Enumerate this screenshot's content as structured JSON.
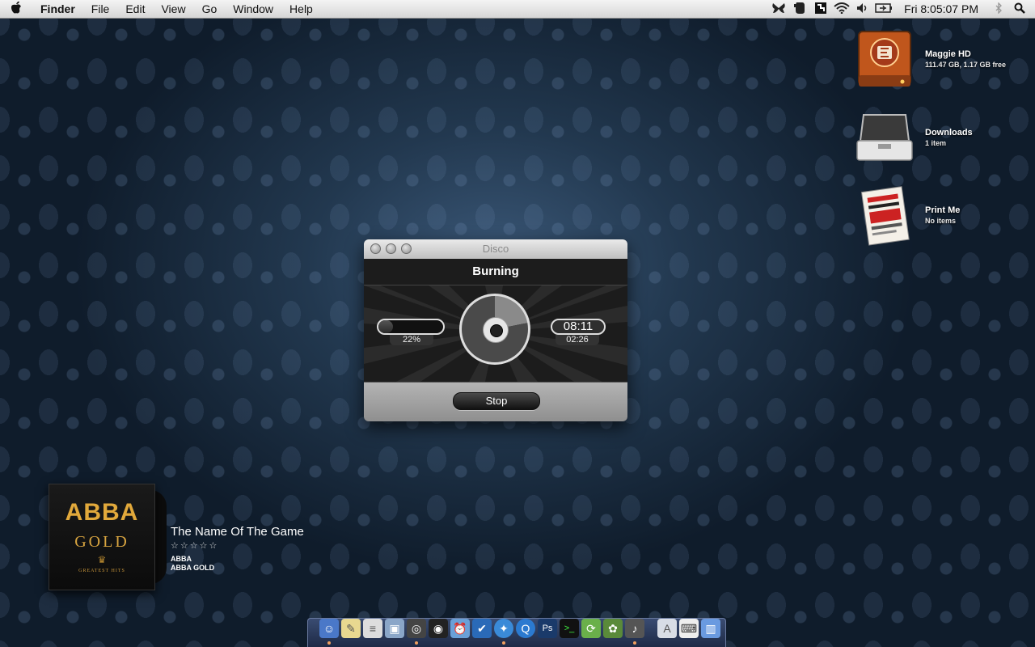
{
  "menubar": {
    "app_name": "Finder",
    "menus": [
      "File",
      "Edit",
      "View",
      "Go",
      "Window",
      "Help"
    ],
    "clock": "Fri 8:05:07 PM",
    "status_icons": [
      "butterfly-icon",
      "evernote-icon",
      "dropbox-icon",
      "wifi-icon",
      "volume-icon",
      "battery-icon",
      "bluetooth-icon",
      "spotlight-search-icon"
    ]
  },
  "desktop": {
    "items": [
      {
        "name": "Maggie HD",
        "subtitle": "111.47 GB, 1.17 GB free",
        "icon": "hard-drive-icon"
      },
      {
        "name": "Downloads",
        "subtitle": "1 item",
        "icon": "briefcase-folder-icon"
      },
      {
        "name": "Print Me",
        "subtitle": "No items",
        "icon": "poster-folder-icon"
      }
    ]
  },
  "disco": {
    "window_title": "Disco",
    "status": "Burning",
    "progress_percent": 22,
    "progress_label": "22%",
    "elapsed": "08:11",
    "remaining": "02:26",
    "stop_label": "Stop"
  },
  "now_playing": {
    "album_art_artist": "ABBA",
    "album_art_title": "GOLD",
    "album_art_subtitle": "GREATEST HITS",
    "track": "The Name Of The Game",
    "rating": "☆☆☆☆☆",
    "artist": "ABBA",
    "album": "ABBA GOLD"
  },
  "dock": {
    "items": [
      "finder-icon",
      "stickies-icon",
      "textedit-icon",
      "preview-icon",
      "cassette-icon",
      "camera-icon",
      "alarm-clock-icon",
      "todo-icon",
      "safari-icon",
      "quicktime-icon",
      "photoshop-icon",
      "terminal-icon",
      "sync-icon",
      "evernote-icon",
      "itunes-icon",
      "applications-folder-icon",
      "keyboard-icon",
      "trash-icon"
    ]
  }
}
